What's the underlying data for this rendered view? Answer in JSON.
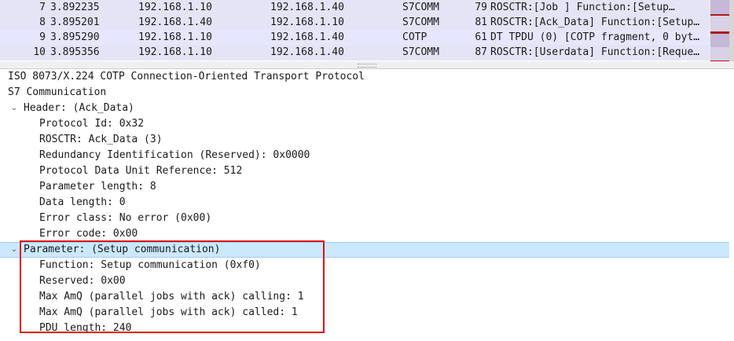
{
  "packet_list": {
    "rows": [
      {
        "no": "7",
        "time": "3.892235",
        "source": "192.168.1.10",
        "destination": "192.168.1.40",
        "protocol": "S7COMM",
        "length": "79",
        "info": "ROSCTR:[Job      ] Function:[Setup…",
        "bg": "#e4e4f6",
        "minimap_color": "#c5b8d8"
      },
      {
        "no": "8",
        "time": "3.895201",
        "source": "192.168.1.40",
        "destination": "192.168.1.10",
        "protocol": "S7COMM",
        "length": "81",
        "info": "ROSCTR:[Ack_Data] Function:[Setup…",
        "bg": "#e4e4f6",
        "minimap_color": "#c5b8d8"
      },
      {
        "no": "9",
        "time": "3.895290",
        "source": "192.168.1.10",
        "destination": "192.168.1.40",
        "protocol": "COTP",
        "length": "61",
        "info": "DT TPDU (0) [COTP fragment, 0 byt…",
        "bg": "#e7e6ff",
        "minimap_color": "#b01818"
      },
      {
        "no": "10",
        "time": "3.895356",
        "source": "192.168.1.10",
        "destination": "192.168.1.40",
        "protocol": "S7COMM",
        "length": "87",
        "info": "ROSCTR:[Userdata] Function:[Reque…",
        "bg": "#e4e4f6",
        "minimap_color": "#c5b8d8"
      }
    ]
  },
  "detail_tree": {
    "rows": [
      {
        "text": "ISO 8073/X.224 COTP Connection-Oriented Transport Protocol",
        "expander": "›"
      },
      {
        "text": "S7 Communication",
        "expander": "⌄"
      },
      {
        "text": "Header: (Ack_Data)",
        "expander": "⌄"
      },
      {
        "text": "Protocol Id: 0x32",
        "expander": ""
      },
      {
        "text": "ROSCTR: Ack_Data (3)",
        "expander": ""
      },
      {
        "text": "Redundancy Identification (Reserved): 0x0000",
        "expander": ""
      },
      {
        "text": "Protocol Data Unit Reference: 512",
        "expander": ""
      },
      {
        "text": "Parameter length: 8",
        "expander": ""
      },
      {
        "text": "Data length: 0",
        "expander": ""
      },
      {
        "text": "Error class: No error (0x00)",
        "expander": ""
      },
      {
        "text": "Error code: 0x00",
        "expander": ""
      },
      {
        "text": "Parameter: (Setup communication)",
        "expander": "⌄",
        "selected": true
      },
      {
        "text": "Function: Setup communication (0xf0)",
        "expander": ""
      },
      {
        "text": "Reserved: 0x00",
        "expander": ""
      },
      {
        "text": "Max AmQ (parallel jobs with ack) calling: 1",
        "expander": ""
      },
      {
        "text": "Max AmQ (parallel jobs with ack) called: 1",
        "expander": ""
      },
      {
        "text": "PDU length: 240",
        "expander": ""
      }
    ]
  },
  "colors": {
    "selection": "#cce8ff",
    "highlight_box": "#e01010"
  }
}
